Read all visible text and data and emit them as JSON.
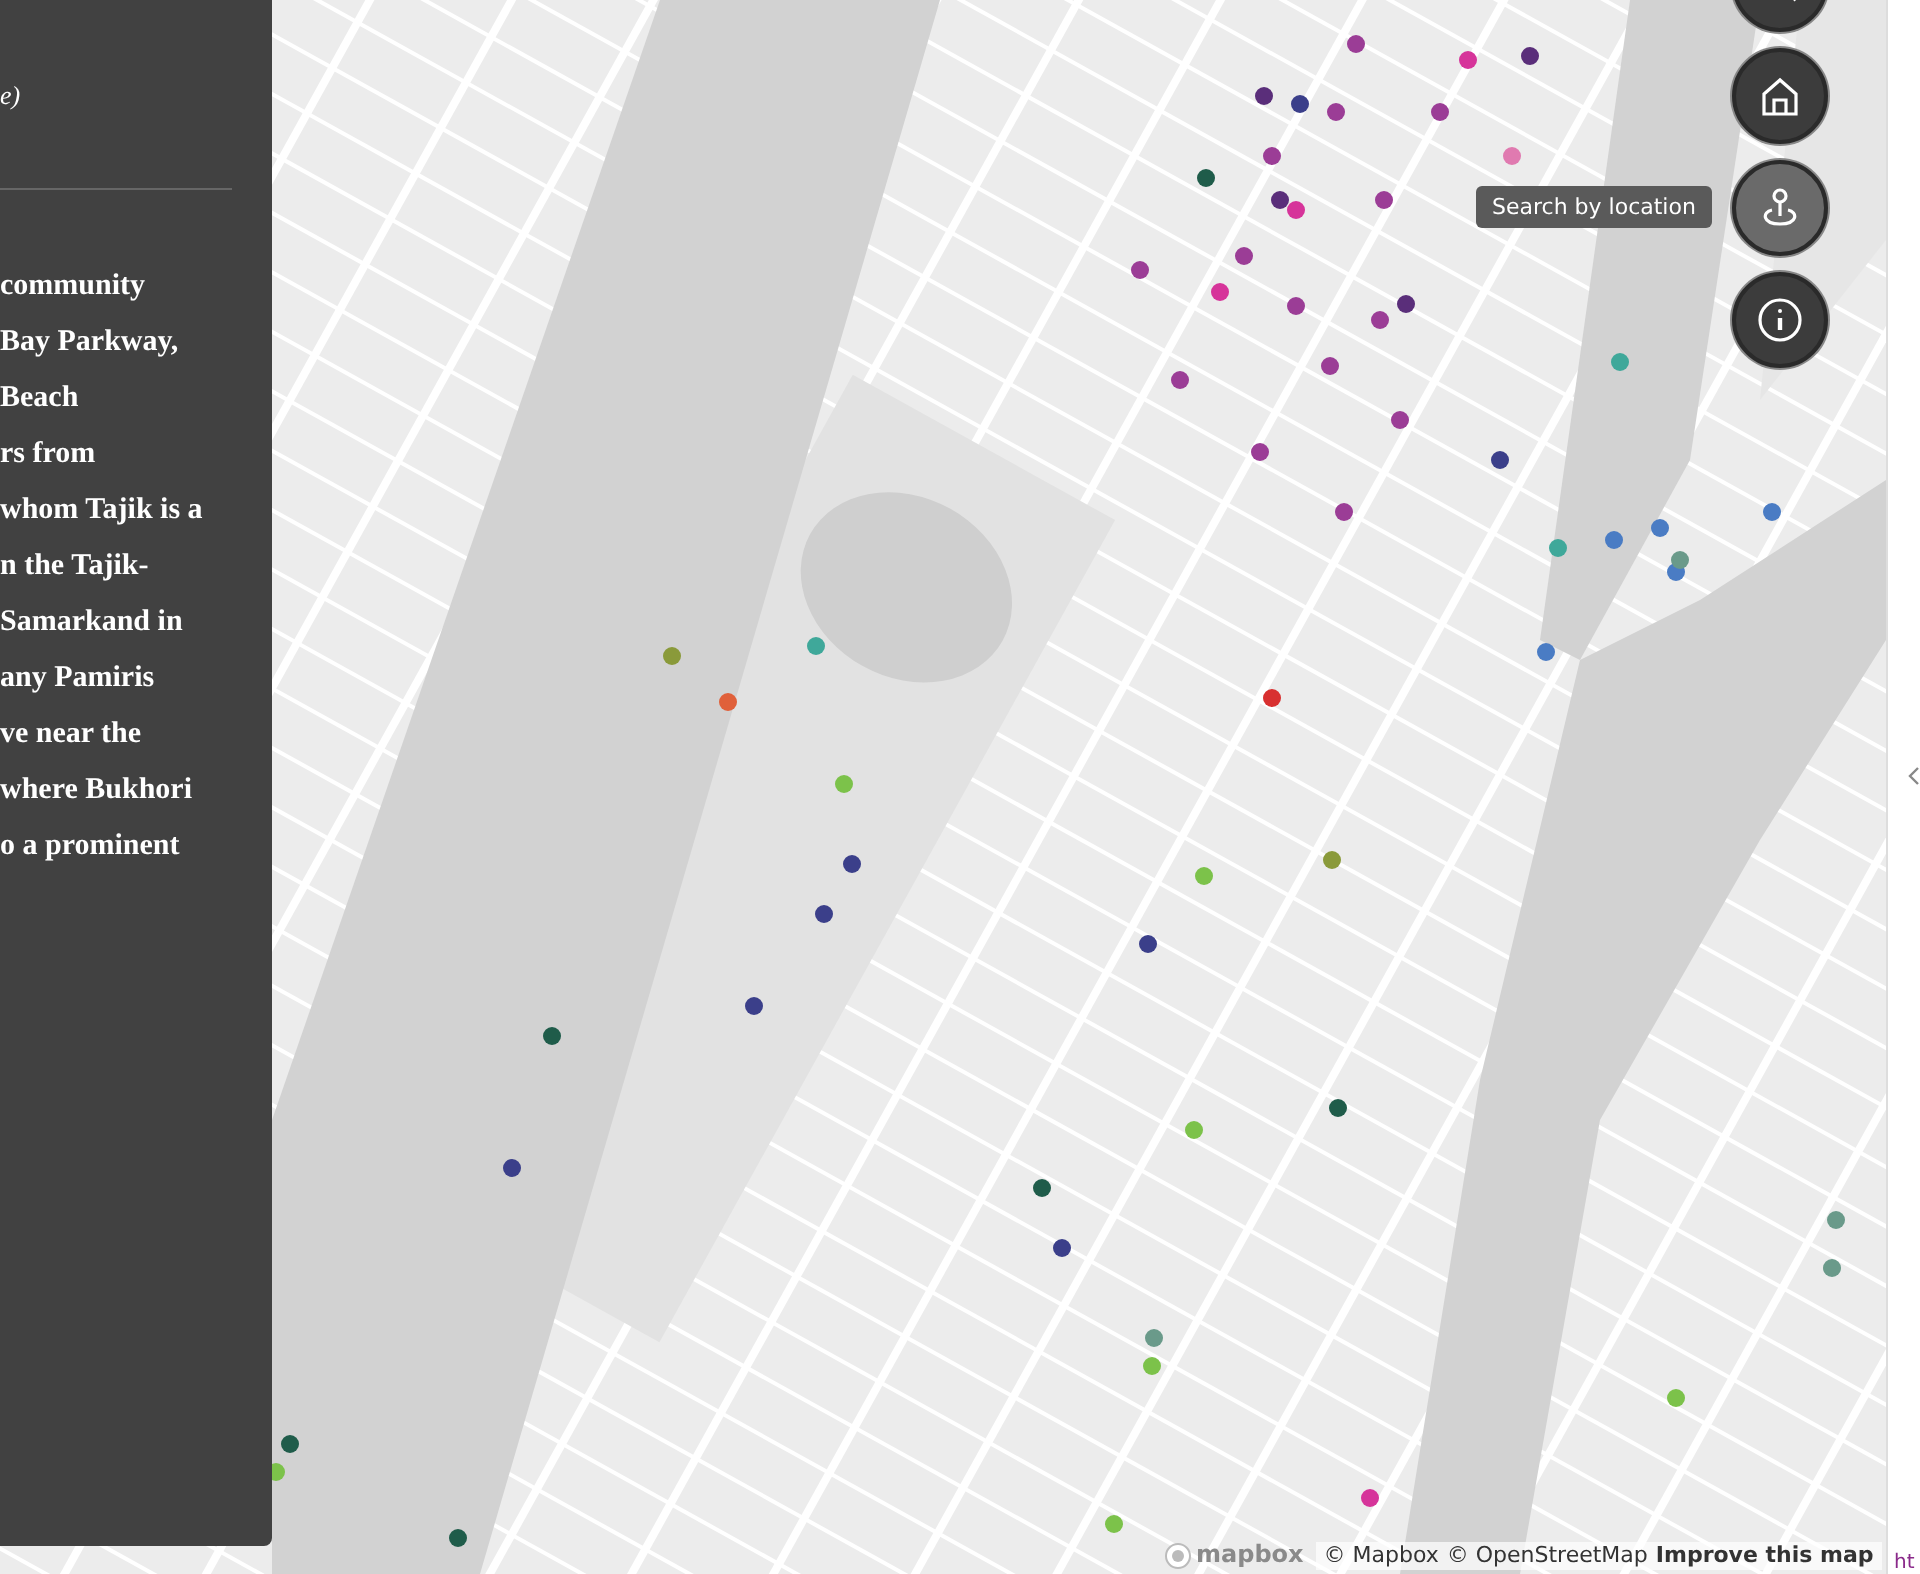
{
  "side_panel": {
    "subtitle": "e)",
    "lines": [
      "community",
      "Bay Parkway,",
      "Beach",
      "rs from",
      "whom Tajik is a",
      "n the Tajik-",
      "Samarkand in",
      "any Pamiris",
      "ve near the",
      "where Bukhori",
      "o a prominent"
    ]
  },
  "map_controls": [
    {
      "kind": "search",
      "selected": false
    },
    {
      "kind": "home",
      "selected": false
    },
    {
      "kind": "location",
      "selected": true
    },
    {
      "kind": "info",
      "selected": false
    }
  ],
  "tooltip": {
    "text": "Search by location"
  },
  "attribution": {
    "logo_text": "mapbox",
    "links": [
      "© Mapbox",
      "© OpenStreetMap",
      "Improve this map"
    ]
  },
  "side_strip": {
    "link": "ht"
  }
}
